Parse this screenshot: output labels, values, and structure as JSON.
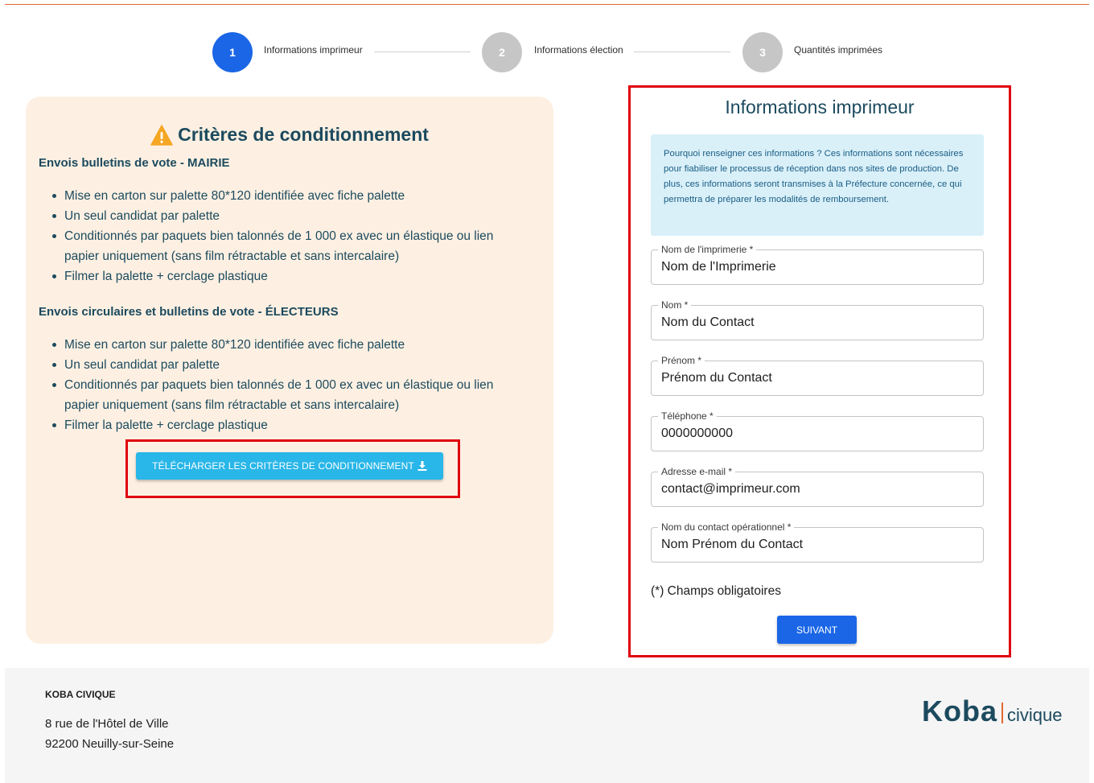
{
  "stepper": {
    "steps": [
      {
        "number": "1",
        "label": "Informations imprimeur",
        "status": "active"
      },
      {
        "number": "2",
        "label": "Informations élection",
        "status": "inactive"
      },
      {
        "number": "3",
        "label": "Quantités imprimées",
        "status": "inactive"
      }
    ]
  },
  "criteria": {
    "title": "Critères de conditionnement",
    "icon": "warning-icon",
    "sections": [
      {
        "heading": "Envois bulletins de vote - MAIRIE",
        "items": [
          "Mise en carton sur palette 80*120 identifiée avec fiche palette",
          "Un seul candidat par palette",
          "Conditionnés par paquets bien talonnés de 1 000 ex avec un élastique ou lien papier uniquement (sans film rétractable et sans intercalaire)",
          "Filmer la palette + cerclage plastique"
        ]
      },
      {
        "heading": "Envois circulaires et bulletins de vote - ÉLECTEURS",
        "items": [
          "Mise en carton sur palette 80*120 identifiée avec fiche palette",
          "Un seul candidat par palette",
          "Conditionnés par paquets bien talonnés de 1 000 ex avec un élastique ou lien papier uniquement (sans film rétractable et sans intercalaire)",
          "Filmer la palette + cerclage plastique"
        ]
      }
    ],
    "download_label": "TÉLÉCHARGER LES CRITÈRES DE CONDITIONNEMENT"
  },
  "form": {
    "title": "Informations imprimeur",
    "info_text": "Pourquoi renseigner ces informations ? Ces informations sont nécessaires pour fiabiliser le processus de réception dans nos sites de production. De plus, ces informations seront transmises à la Préfecture concernée, ce qui permettra de préparer les modalités de remboursement.",
    "fields": {
      "printer_name": {
        "label": "Nom de l'imprimerie *",
        "value": "Nom de l'Imprimerie"
      },
      "last_name": {
        "label": "Nom *",
        "value": "Nom du Contact"
      },
      "first_name": {
        "label": "Prénom *",
        "value": "Prénom du Contact"
      },
      "phone": {
        "label": "Téléphone *",
        "value": "0000000000"
      },
      "email": {
        "label": "Adresse e-mail *",
        "value": "contact@imprimeur.com"
      },
      "ops_contact": {
        "label": "Nom du contact opérationnel *",
        "value": "Nom Prénom du Contact"
      }
    },
    "required_note": "(*) Champs obligatoires",
    "next_label": "SUIVANT"
  },
  "footer": {
    "company": "KOBA CIVIQUE",
    "address_line1": "8 rue de l'Hôtel de Ville",
    "address_line2": "92200 Neuilly-sur-Seine",
    "logo_main": "Koba",
    "logo_sub": "civique"
  },
  "colors": {
    "primary": "#1a66e6",
    "accent_orange": "#e2672f",
    "download_button": "#29b6e8",
    "heading_text": "#1c4a5e",
    "highlight_outline": "#e0000f"
  }
}
